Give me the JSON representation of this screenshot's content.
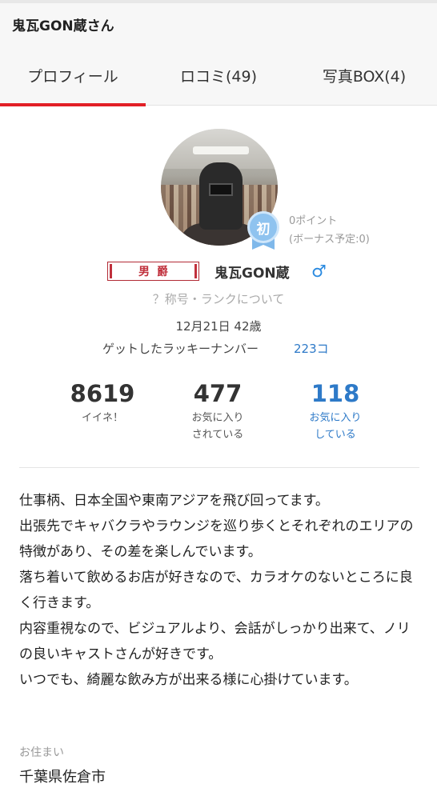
{
  "header": {
    "title": "鬼瓦GON蔵さん"
  },
  "tabs": [
    {
      "label": "プロフィール",
      "active": true
    },
    {
      "label": "ロコミ(49)"
    },
    {
      "label": "写真BOX(4)"
    }
  ],
  "profile": {
    "badge": "初",
    "points": "0ポイント",
    "bonus": "(ボーナス予定:0)",
    "rank_title": "男爵",
    "name": "鬼瓦GON蔵",
    "gender_symbol": "♂",
    "help_link": "？称号・ランクについて",
    "birthday_age": "12月21日 42歳",
    "lucky_label": "ゲットしたラッキーナンバー",
    "lucky_count": "223コ"
  },
  "stats": [
    {
      "value": "8619",
      "label": "イイネ！"
    },
    {
      "value": "477",
      "label": "お気に入り\nされている"
    },
    {
      "value": "118",
      "label": "お気に入り\nしている"
    }
  ],
  "bio": "仕事柄、日本全国や東南アジアを飛び回ってます。\n出張先でキャバクラやラウンジを巡り歩くとそれぞれのエリアの特徴があり、その差を楽しんでいます。\n落ち着いて飲めるお店が好きなので、カラオケのないところに良く行きます。\n内容重視なので、ビジュアルより、会話がしっかり出来て、ノリの良いキャストさんが好きです。\nいつでも、綺麗な飲み方が出来る様に心掛けています。",
  "residence": {
    "label": "お住まい",
    "value": "千葉県佐倉市"
  },
  "colors": {
    "accent": "#e21f26",
    "link": "#2e7ac8",
    "badge": "#8fc3ef",
    "rank": "#c0303c"
  }
}
